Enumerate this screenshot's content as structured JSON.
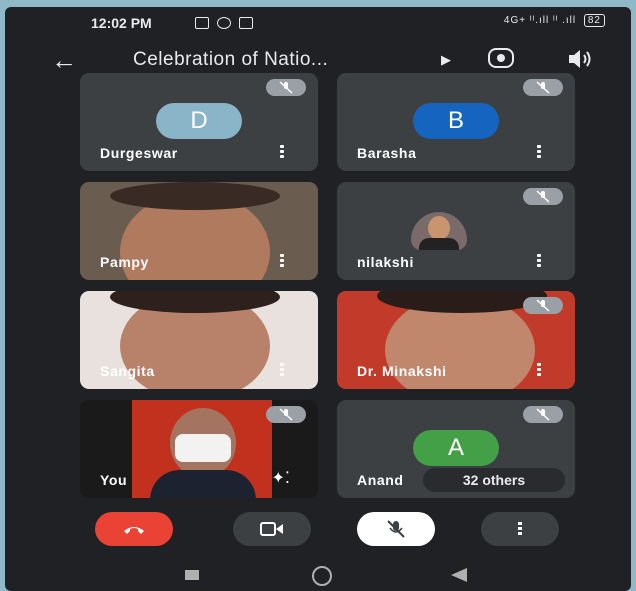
{
  "status_bar": {
    "time": "12:02 PM",
    "notification_icons": [
      "gallery-icon",
      "record-icon",
      "calendar-icon"
    ],
    "network_text": "4G+ ᴵᴵ.ıll  ᴵᴵ .ıll",
    "battery": "82"
  },
  "app_bar": {
    "title": "Celebration of Natio...",
    "title_expand_icon": "caret-right-icon",
    "back_icon": "arrow-back-icon",
    "switch_camera_icon": "flip-camera-icon",
    "audio_icon": "speaker-icon"
  },
  "participants": [
    {
      "name": "Durgeswar",
      "avatar_letter": "D",
      "avatar_color": "#8ab4c8",
      "muted": true
    },
    {
      "name": "Barasha",
      "avatar_letter": "B",
      "avatar_color": "#1565c0",
      "muted": true
    },
    {
      "name": "Pampy",
      "muted": false,
      "video": true
    },
    {
      "name": "nilakshi",
      "muted": true,
      "profile_photo": true
    },
    {
      "name": "Sangita",
      "muted": false,
      "video": true
    },
    {
      "name": "Dr. Minakshi",
      "muted": true,
      "video": true
    },
    {
      "name": "You",
      "muted": true,
      "video": true
    },
    {
      "name": "Anand",
      "avatar_letter": "A",
      "avatar_color": "#43a047",
      "muted": true
    }
  ],
  "others_label": "32 others",
  "controls": {
    "end_call_icon": "call-end-icon",
    "camera_icon": "videocam-icon",
    "mic_icon": "mic-off-icon",
    "more_icon": "more-vert-icon"
  },
  "colors": {
    "background": "#202124",
    "tile": "#3c4043",
    "end_call": "#ea4335",
    "mute_badge": "#9aa0a6"
  }
}
